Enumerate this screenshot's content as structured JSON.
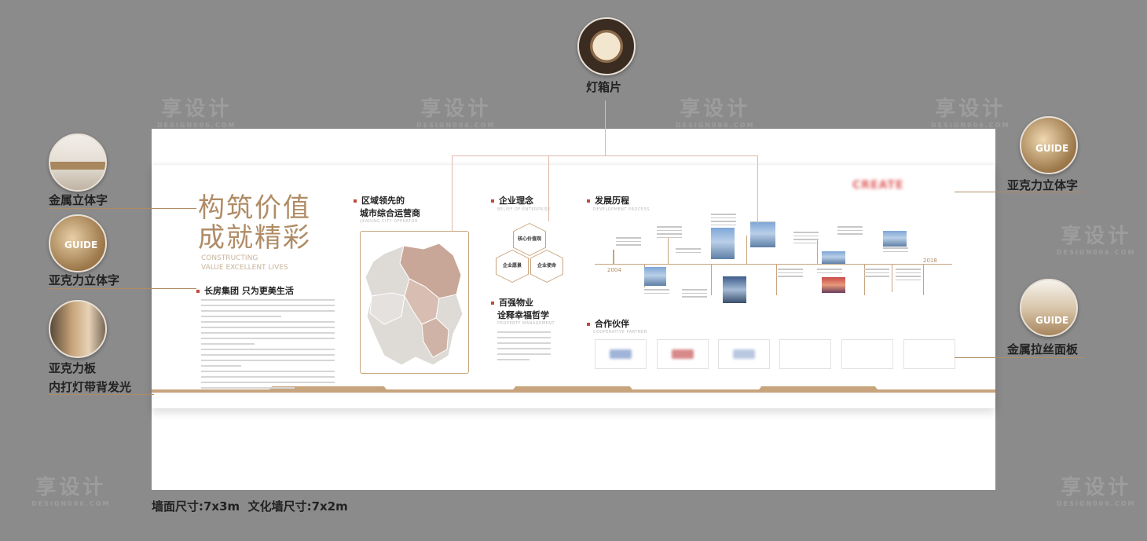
{
  "watermark": {
    "text": "享设计",
    "sub": "DESIGN006.COM"
  },
  "callouts": {
    "top": "灯箱片",
    "left_1": "金属立体字",
    "left_2": "亚克力立体字",
    "left_3_line1": "亚克力板",
    "left_3_line2": "内打灯带背发光",
    "right_1": "亚克力立体字",
    "right_2": "金属拉丝面板"
  },
  "thumb_text": {
    "guide": "GUIDE"
  },
  "headline": {
    "line1": "构筑价值",
    "line2": "成就精彩",
    "en1": "CONSTRUCTING",
    "en2": "VALUE EXCELLENT LIVES"
  },
  "group_title": "长房集团 只为更美生活",
  "region": {
    "title1": "区域领先的",
    "title2": "城市综合运营商",
    "sub": "LEADING CITY OPERATOR"
  },
  "philosophy": {
    "title": "企业理念",
    "sub": "BELIEF OF ENTERPRISE",
    "hex": [
      "核心价值观",
      "企业愿景",
      "企业使命"
    ]
  },
  "property": {
    "title1": "百强物业",
    "title2": "诠释幸福哲学",
    "sub": "PROPERTY MANAGEMENT"
  },
  "history": {
    "title": "发展历程",
    "sub": "DEVELOPMENT PROCESS",
    "start_year": "2004",
    "end_year": "2018"
  },
  "partners": {
    "title": "合作伙伴",
    "sub": "COOPERATIVE PARTNER"
  },
  "brand_logo": "CREATE",
  "dimensions": "墙面尺寸:7x3m  文化墙尺寸:7x2m",
  "colors": {
    "accent": "#b08c66",
    "band": "#c8a47e",
    "background": "#8b8b8b"
  }
}
